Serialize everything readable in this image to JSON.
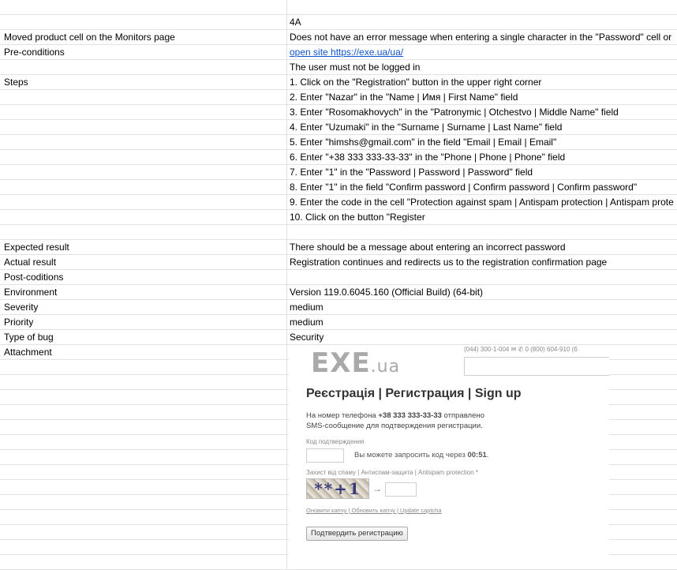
{
  "rows": [
    {
      "label": "",
      "value": ""
    },
    {
      "label": "",
      "value": "4A"
    },
    {
      "label": "Moved product cell on the Monitors page",
      "value": "Does not have an error message when entering a single character in the \"Password\" cell or"
    },
    {
      "label": "Pre-conditions",
      "value": "open site https://exe.ua/ua/",
      "is_link": true
    },
    {
      "label": "",
      "value": "The user must not be logged in"
    },
    {
      "label": "Steps",
      "value": "1. Click on the \"Registration\" button in the upper right corner"
    },
    {
      "label": "",
      "value": "2. Enter \"Nazar\" in the \"Name | Имя | First Name\" field"
    },
    {
      "label": "",
      "value": "3. Enter \"Rosomakhovych\" in the \"Patronymic | Otchestvo | Middle Name\" field"
    },
    {
      "label": "",
      "value": "4. Enter \"Uzumaki\" in the \"Surname | Surname | Last Name\" field"
    },
    {
      "label": "",
      "value": "5. Enter \"himshs@gmail.com\" in the field \"Email | Email | Email\""
    },
    {
      "label": "",
      "value": "6. Enter \"+38 333 333-33-33\" in the \"Phone | Phone | Phone\" field"
    },
    {
      "label": "",
      "value": "7. Enter \"1\" in the \"Password | Password | Password\" field"
    },
    {
      "label": "",
      "value": "8. Enter \"1\" in the field \"Confirm password | Confirm password | Confirm password\""
    },
    {
      "label": "",
      "value": "9. Enter the code in the cell \"Protection against spam | Antispam protection | Antispam prote"
    },
    {
      "label": "",
      "value": "10. Click on the button \"Register"
    },
    {
      "label": "",
      "value": ""
    },
    {
      "label": "Expected result",
      "value": "There should be a message about entering an incorrect password"
    },
    {
      "label": "Actual result",
      "value": "Registration continues and redirects us to the registration confirmation page"
    },
    {
      "label": "Post-coditions",
      "value": ""
    },
    {
      "label": "Environment",
      "value": "Version 119.0.6045.160 (Official Build) (64-bit)"
    },
    {
      "label": "Severity",
      "value": "medium"
    },
    {
      "label": "Priority",
      "value": "medium"
    },
    {
      "label": "Type of bug",
      "value": "Security"
    },
    {
      "label": "Attachment",
      "value": ""
    },
    {
      "label": "",
      "value": ""
    },
    {
      "label": "",
      "value": ""
    },
    {
      "label": "",
      "value": ""
    },
    {
      "label": "",
      "value": ""
    },
    {
      "label": "",
      "value": ""
    },
    {
      "label": "",
      "value": ""
    },
    {
      "label": "",
      "value": ""
    },
    {
      "label": "",
      "value": ""
    },
    {
      "label": "",
      "value": ""
    },
    {
      "label": "",
      "value": ""
    },
    {
      "label": "",
      "value": ""
    },
    {
      "label": "",
      "value": ""
    },
    {
      "label": "",
      "value": ""
    },
    {
      "label": "",
      "value": ""
    }
  ],
  "attachment": {
    "topbar": "(044) 300-1-004  ✉ ✆ 0 (800) 604-910 (б",
    "logo_main": "EXE",
    "logo_suffix": ".ua",
    "title": "Реєстрація | Регистрация | Sign up",
    "msg_pre": "На номер телефона ",
    "msg_phone": "+38 333 333-33-33",
    "msg_post": " отправлено SMS-сообщение для подтверждения регистрации.",
    "code_label": "Код подтверждения",
    "resend_pre": "Вы можете запросить код через ",
    "resend_time": "00:51",
    "resend_post": ".",
    "spam_label": "Захист від спаму | Антиспам-защита | Antispam protection *",
    "captcha_text": "**+1",
    "captcha_links": "Оновити капчу | Обновить капчу | Update captcha",
    "submit_label": "Подтвердить регистрацию"
  }
}
